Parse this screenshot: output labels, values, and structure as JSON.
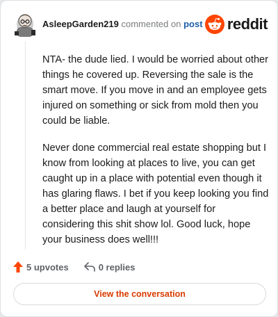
{
  "comment": {
    "username": "AsleepGarden219",
    "commented_text": "commented on",
    "post_link": "post",
    "paragraphs": [
      "NTA- the dude lied. I would be worried about other things he covered up. Reversing the sale is the smart move. If you move in and an employee gets injured on something or sick from mold then you could be liable.",
      "Never done commercial real estate shopping but I know from looking at places to live, you can get caught up in a place with potential even though it has glaring flaws. I bet if you keep looking you find a better place and laugh at yourself for considering this shit show lol. Good luck, hope your business does well!!!"
    ],
    "upvotes_label": "5 upvotes",
    "replies_label": "0 replies"
  },
  "brand": {
    "wordmark": "reddit",
    "icon": "reddit-snoo-icon",
    "color": "#ff4500"
  },
  "footer": {
    "view_button": "View the conversation"
  },
  "colors": {
    "upvote": "#ff4500",
    "link": "#1e5fa8",
    "button_text": "#d93a00"
  }
}
